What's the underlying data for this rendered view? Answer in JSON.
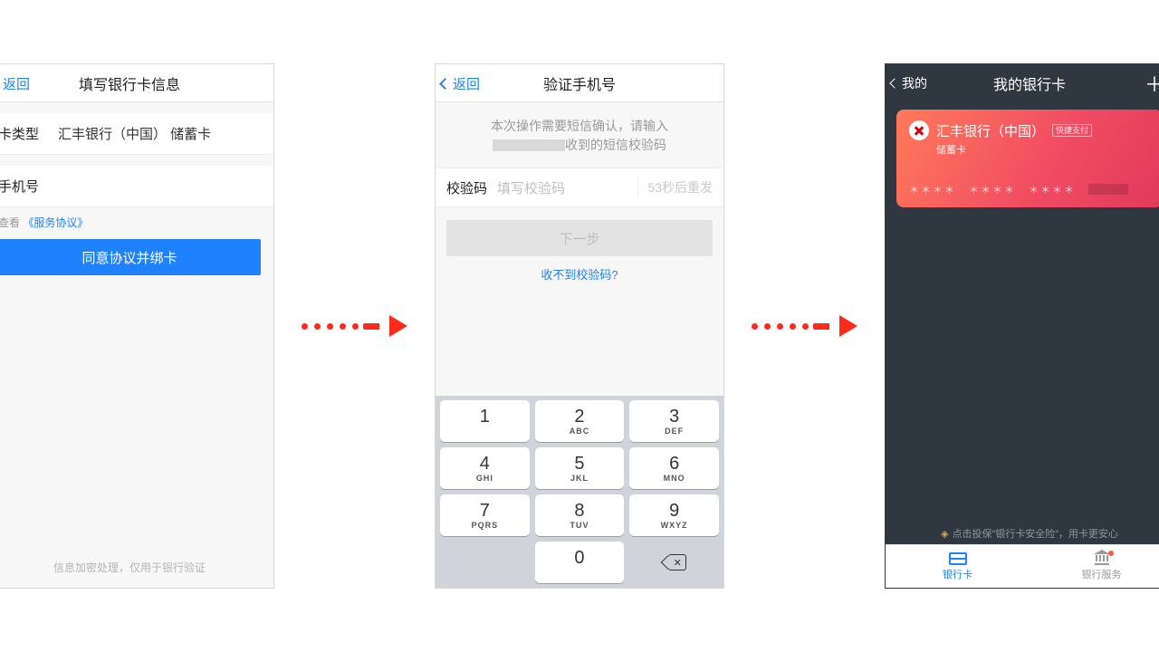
{
  "screen1": {
    "back": "返回",
    "title": "填写银行卡信息",
    "cardTypeLabel": "卡类型",
    "cardTypeValue": "汇丰银行（中国） 储蓄卡",
    "phoneLabel": "手机号",
    "agreementPrefix": "查看",
    "agreementLink": "《服务协议》",
    "submit": "同意协议并绑卡",
    "footer": "信息加密处理，仅用于银行验证"
  },
  "screen2": {
    "back": "返回",
    "title": "验证手机号",
    "msg1": "本次操作需要短信确认，请输入",
    "msg2": "收到的短信校验码",
    "codeLabel": "校验码",
    "codePlaceholder": "填写校验码",
    "resend": "53秒后重发",
    "next": "下一步",
    "help": "收不到校验码?",
    "keys": [
      {
        "n": "1",
        "l": ""
      },
      {
        "n": "2",
        "l": "ABC"
      },
      {
        "n": "3",
        "l": "DEF"
      },
      {
        "n": "4",
        "l": "GHI"
      },
      {
        "n": "5",
        "l": "JKL"
      },
      {
        "n": "6",
        "l": "MNO"
      },
      {
        "n": "7",
        "l": "PQRS"
      },
      {
        "n": "8",
        "l": "TUV"
      },
      {
        "n": "9",
        "l": "WXYZ"
      },
      {
        "n": "",
        "l": ""
      },
      {
        "n": "0",
        "l": ""
      },
      {
        "n": "⌫",
        "l": ""
      }
    ]
  },
  "screen3": {
    "back": "我的",
    "title": "我的银行卡",
    "bankName": "汇丰银行（中国）",
    "quickBadge": "快捷支付",
    "cardType": "储蓄卡",
    "mask": "＊＊＊＊",
    "insure": "点击投保“银行卡安全险”，用卡更安心",
    "tab1": "银行卡",
    "tab2": "银行服务"
  }
}
